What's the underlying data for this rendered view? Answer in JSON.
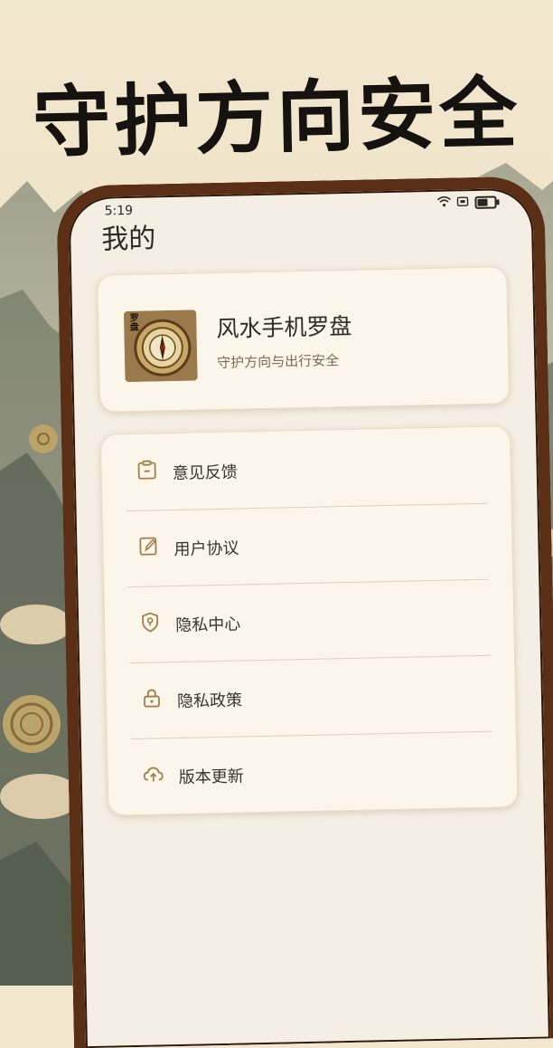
{
  "promo": {
    "headline": "守护方向安全"
  },
  "status_bar": {
    "time": "5:19",
    "icons": [
      "wifi-icon",
      "signal-icon",
      "battery-icon"
    ],
    "battery_level": 0.7
  },
  "header": {
    "title": "我的"
  },
  "app_card": {
    "logo_icon": "compass-logo",
    "logo_text": "罗盘",
    "name": "风水手机罗盘",
    "tagline": "守护方向与出行安全"
  },
  "menu": {
    "items": [
      {
        "label": "意见反馈",
        "icon": "feedback-icon"
      },
      {
        "label": "用户协议",
        "icon": "edit-icon"
      },
      {
        "label": "隐私中心",
        "icon": "shield-location-icon"
      },
      {
        "label": "隐私政策",
        "icon": "lock-icon"
      },
      {
        "label": "版本更新",
        "icon": "cloud-upload-icon"
      }
    ]
  },
  "colors": {
    "accent": "#a07f4a",
    "frame": "#5a2f16",
    "background": "#f5efe3",
    "card": "#fbf6e9"
  }
}
